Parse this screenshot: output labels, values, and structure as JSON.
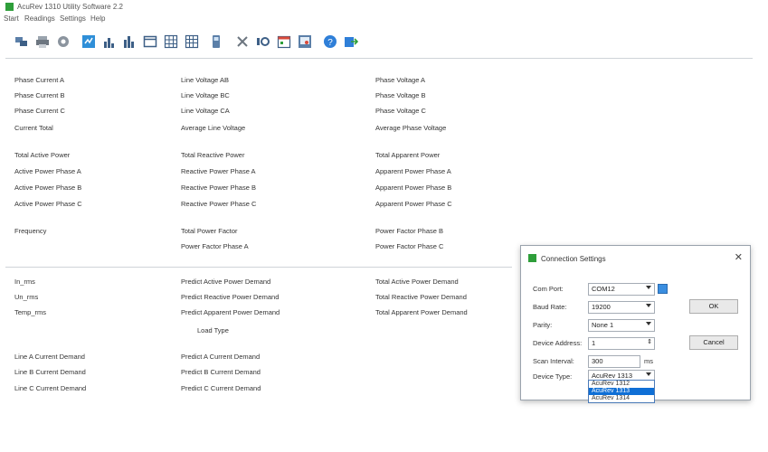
{
  "app": {
    "title": "AcuRev 1310 Utility Software 2.2",
    "accent": "#2e9e3a"
  },
  "menu": [
    "Start",
    "Readings",
    "Settings",
    "Help"
  ],
  "toolbar": {
    "icons": [
      "network-icon",
      "printer-icon",
      "gear-icon",
      "realtime-icon",
      "bar-chart-icon",
      "bar-chart-2-icon",
      "window-icon",
      "grid-icon",
      "grid-2-icon",
      "device-icon",
      "tools-icon",
      "io-icon",
      "calendar-icon",
      "screen-icon",
      "help-icon",
      "export-icon"
    ]
  },
  "readings": {
    "col1": [
      "Phase Current A",
      "Phase Current B",
      "Phase Current C",
      "Current Total",
      "Total Active Power",
      "Active Power Phase A",
      "Active Power Phase B",
      "Active Power Phase C",
      "Frequency"
    ],
    "col2": [
      "Line Voltage AB",
      "Line Voltage BC",
      "Line Voltage CA",
      "Average Line Voltage",
      "Total Reactive Power",
      "Reactive Power Phase A",
      "Reactive Power Phase B",
      "Reactive Power Phase C",
      "Total Power Factor",
      "Power Factor Phase A"
    ],
    "col3": [
      "Phase Voltage A",
      "Phase Voltage B",
      "Phase Voltage C",
      "Average Phase Voltage",
      "Total Apparent Power",
      "Apparent Power Phase A",
      "Apparent Power Phase B",
      "Apparent Power Phase C",
      "Power Factor Phase B",
      "Power Factor Phase C"
    ]
  },
  "demand": {
    "col1": [
      "In_rms",
      "Un_rms",
      "Temp_rms",
      "Line A Current Demand",
      "Line B Current Demand",
      "Line C Current Demand"
    ],
    "col2": [
      "Predict Active Power Demand",
      "Predict Reactive Power Demand",
      "Predict Apparent Power Demand",
      "Load Type",
      "Predict A Current Demand",
      "Predict B Current Demand",
      "Predict C Current Demand"
    ],
    "col3": [
      "Total Active Power Demand",
      "Total Reactive Power Demand",
      "Total Apparent Power Demand"
    ]
  },
  "dialog": {
    "title": "Connection Settings",
    "close": "✕",
    "com_port_label": "Com Port:",
    "com_port_value": "COM12",
    "baud_label": "Baud Rate:",
    "baud_value": "19200",
    "parity_label": "Parity:",
    "parity_value": "None 1",
    "address_label": "Device Address:",
    "address_value": "1",
    "scan_label": "Scan Interval:",
    "scan_value": "300",
    "scan_unit": "ms",
    "type_label": "Device Type:",
    "type_value": "AcuRev 1313",
    "type_options": [
      "AcuRev 1312",
      "AcuRev 1313",
      "AcuRev 1314"
    ],
    "type_selected_index": 1,
    "ok_label": "OK",
    "cancel_label": "Cancel"
  }
}
